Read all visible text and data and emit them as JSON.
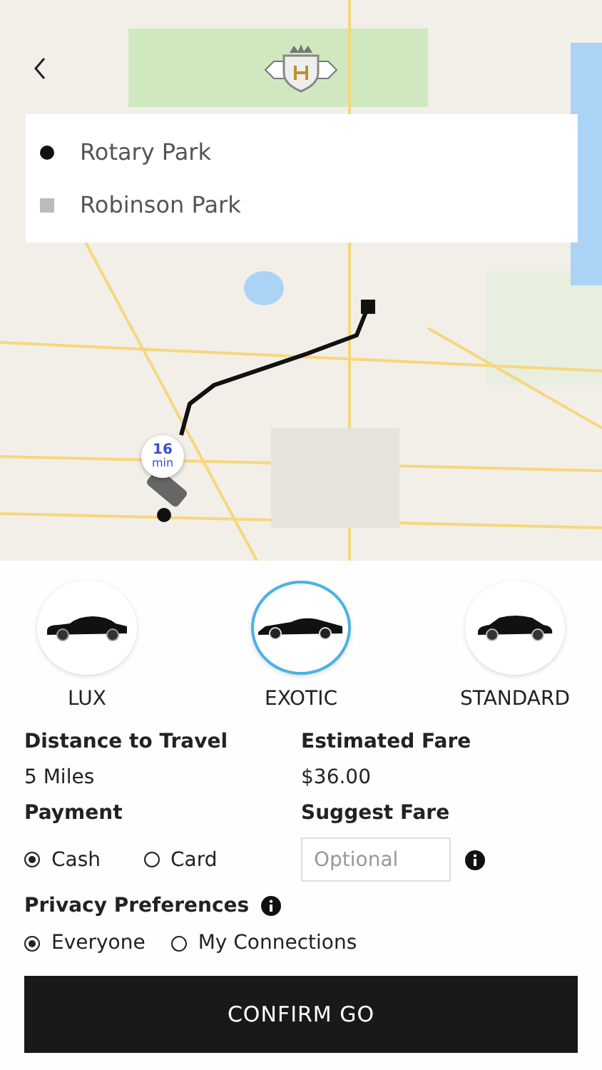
{
  "route": {
    "origin": "Rotary Park",
    "destination": "Robinson Park",
    "eta_value": "16",
    "eta_unit": "min"
  },
  "vehicles": [
    {
      "label": "LUX",
      "kind": "sedan",
      "selected": false
    },
    {
      "label": "EXOTIC",
      "kind": "sports",
      "selected": true
    },
    {
      "label": "STANDARD",
      "kind": "compact",
      "selected": false
    }
  ],
  "distance": {
    "label": "Distance to Travel",
    "value": "5 Miles"
  },
  "fare": {
    "label": "Estimated Fare",
    "value": "$36.00"
  },
  "payment": {
    "label": "Payment",
    "options": [
      {
        "label": "Cash",
        "selected": true
      },
      {
        "label": "Card",
        "selected": false
      }
    ]
  },
  "suggest_fare": {
    "label": "Suggest Fare",
    "placeholder": "Optional"
  },
  "privacy": {
    "label": "Privacy Preferences",
    "options": [
      {
        "label": "Everyone",
        "selected": true
      },
      {
        "label": "My Connections",
        "selected": false
      }
    ]
  },
  "confirm_button": "CONFIRM GO"
}
